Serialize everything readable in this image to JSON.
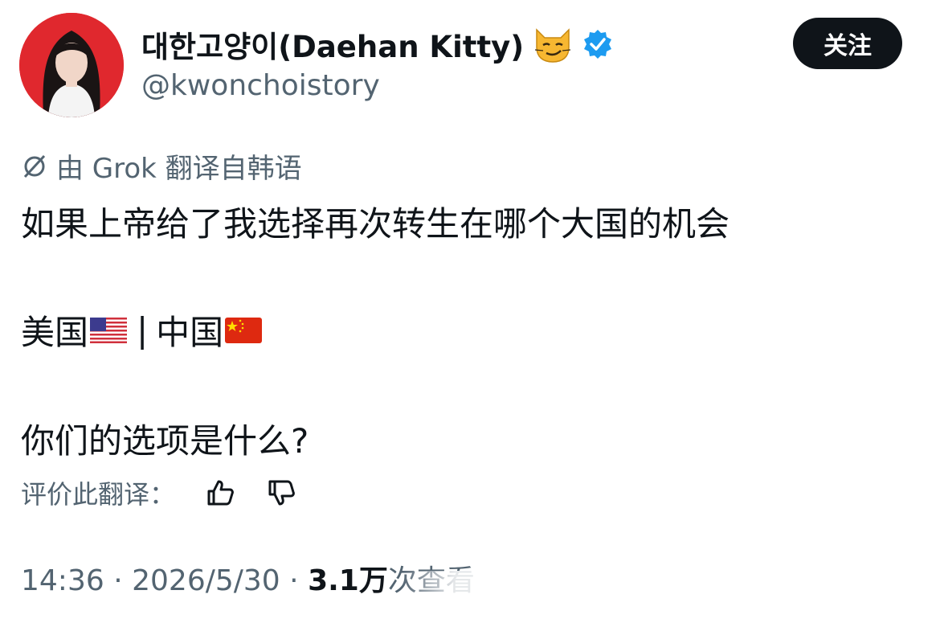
{
  "author": {
    "display_name": "대한고양이(Daehan Kitty)",
    "handle": "@kwonchoistory",
    "verified": true,
    "emoji_icon": "smirking-cat-icon"
  },
  "follow_button": {
    "label": "关注"
  },
  "translation": {
    "note": "由 Grok 翻译自韩语"
  },
  "tweet": {
    "line1": "如果上帝给了我选择再次转生在哪个大国的机会",
    "option_us": "美国",
    "separator": "|",
    "option_cn": "中国",
    "line3": "你们的选项是什么?"
  },
  "rate_translation": {
    "label": "评价此翻译："
  },
  "meta": {
    "time": "14:36",
    "dot1": "·",
    "date": "2026/5/30",
    "dot2": "·",
    "views_count": "3.1万",
    "views_label": "次查看"
  },
  "colors": {
    "avatar_bg": "#e0282e",
    "verified_blue": "#1d9bf0",
    "secondary_text": "#536471",
    "button_bg": "#0f1419"
  }
}
